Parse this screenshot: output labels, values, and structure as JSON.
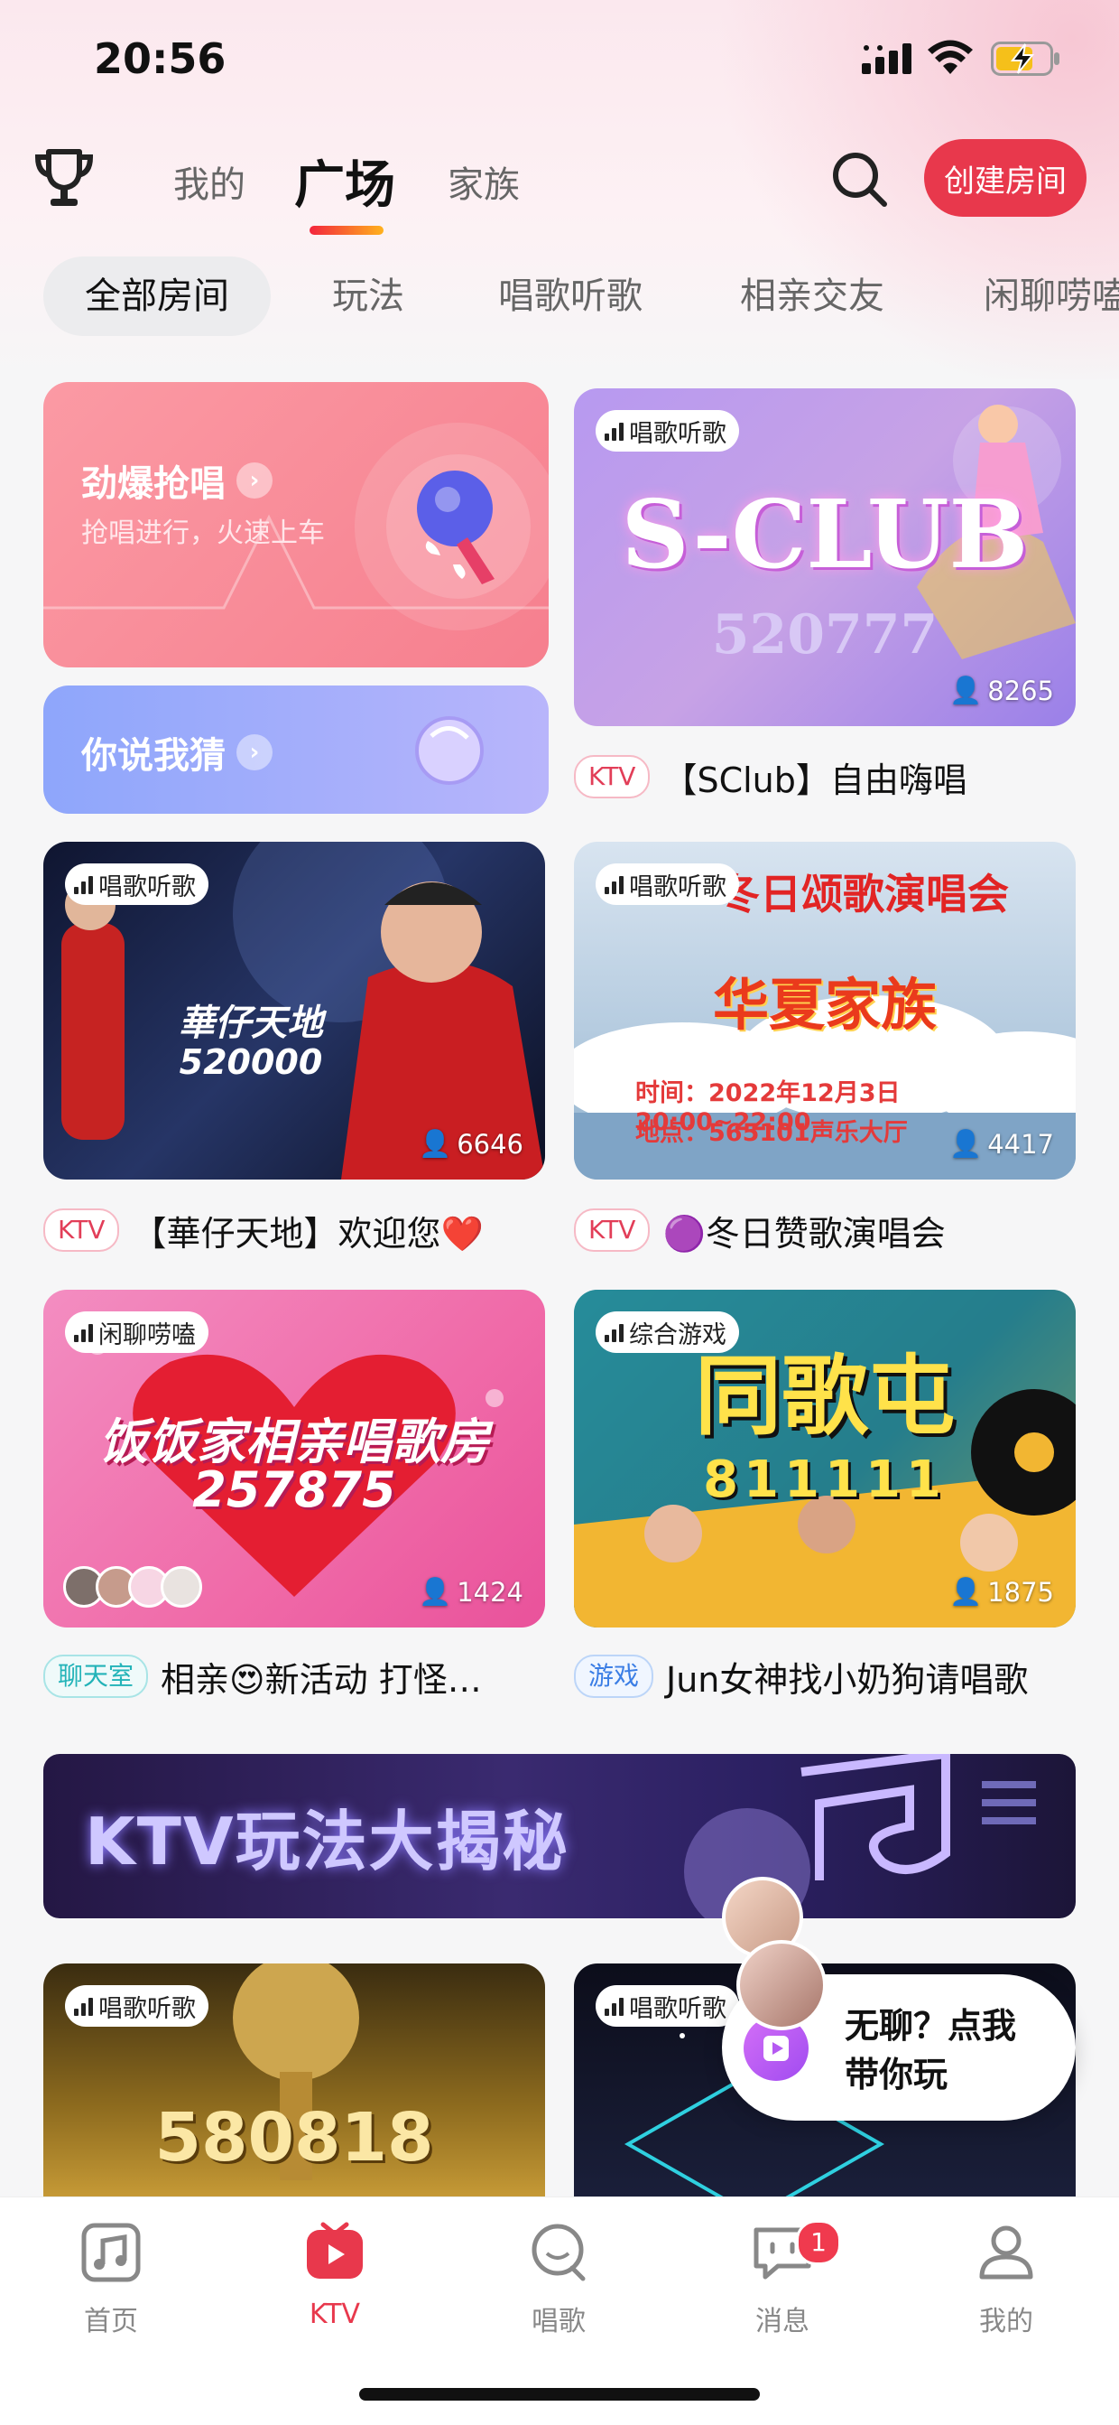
{
  "status": {
    "time": "20:56"
  },
  "header": {
    "tabs": [
      {
        "label": "我的"
      },
      {
        "label": "广场"
      },
      {
        "label": "家族"
      }
    ],
    "create_room_label": "创建房间"
  },
  "categories": [
    "全部房间",
    "玩法",
    "唱歌听歌",
    "相亲交友",
    "闲聊唠嗑"
  ],
  "promos": {
    "grab_sing": {
      "title": "劲爆抢唱",
      "subtitle": "抢唱进行，火速上车"
    },
    "guess": {
      "title": "你说我猜"
    }
  },
  "rooms": [
    {
      "tag": "唱歌听歌",
      "image_title": "S-CLUB",
      "image_number": "520777",
      "viewers": "8265",
      "badge": "KTV",
      "caption": "【SClub】自由嗨唱"
    },
    {
      "tag": "唱歌听歌",
      "image_title": "華仔天地",
      "image_number": "520000",
      "viewers": "6646",
      "badge": "KTV",
      "caption": "【華仔天地】欢迎您❤️"
    },
    {
      "tag": "唱歌听歌",
      "image_title": "华夏家族",
      "image_header": "冬日颂歌演唱会",
      "image_line1": "时间：2022年12月3日 20:00~22:00",
      "image_line2": "地点：565101声乐大厅",
      "viewers": "4417",
      "badge": "KTV",
      "caption": "🟣冬日赞歌演唱会"
    },
    {
      "tag": "闲聊唠嗑",
      "image_title": "饭饭家相亲唱歌房",
      "image_number": "257875",
      "viewers": "1424",
      "badge": "聊天室",
      "caption": "相亲😍新活动 打怪…"
    },
    {
      "tag": "综合游戏",
      "image_title": "同歌屯",
      "image_number": "811111",
      "viewers": "1875",
      "badge": "游戏",
      "caption": "Jun女神找小奶狗请唱歌"
    },
    {
      "tag": "唱歌听歌",
      "image_title": "580818"
    },
    {
      "tag": "唱歌听歌"
    }
  ],
  "banner": {
    "title": "KTV玩法大揭秘"
  },
  "float_bubble": {
    "line1": "无聊？点我",
    "line2": "带你玩"
  },
  "tabbar": [
    {
      "label": "首页"
    },
    {
      "label": "KTV"
    },
    {
      "label": "唱歌"
    },
    {
      "label": "消息",
      "badge": "1"
    },
    {
      "label": "我的"
    }
  ],
  "colors": {
    "accent": "#e8384c",
    "nav_gradient": [
      "#f3253d",
      "#ffb21d"
    ]
  }
}
